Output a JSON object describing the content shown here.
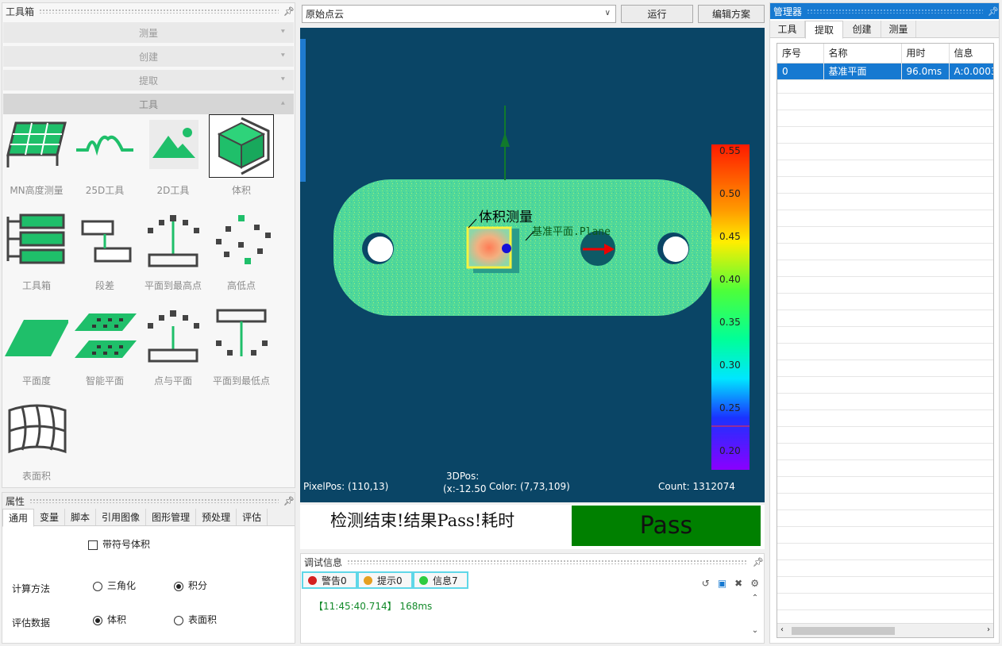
{
  "toolbox": {
    "title": "工具箱",
    "categories": [
      "测量",
      "创建",
      "提取",
      "工具"
    ],
    "tools": [
      "MN高度测量",
      "25D工具",
      "2D工具",
      "体积",
      "工具箱",
      "段差",
      "平面到最高点",
      "高低点",
      "平面度",
      "智能平面",
      "点与平面",
      "平面到最低点",
      "表面积"
    ]
  },
  "properties": {
    "title": "属性",
    "tabs": [
      "通用",
      "变量",
      "脚本",
      "引用图像",
      "图形管理",
      "预处理",
      "评估"
    ],
    "signed_volume_label": "带符号体积",
    "calc_method_label": "计算方法",
    "calc_options": [
      "三角化",
      "积分"
    ],
    "calc_selected": "积分",
    "eval_label": "评估数据",
    "eval_options": [
      "体积",
      "表面积"
    ],
    "eval_selected": "体积"
  },
  "toolbar": {
    "source_select": "原始点云",
    "run_label": "运行",
    "edit_label": "编辑方案"
  },
  "viewer": {
    "measure_label": "体积测量",
    "plane_label": "基准平面.Plane",
    "colorbar_ticks": [
      "0.55",
      "0.50",
      "0.45",
      "0.40",
      "0.35",
      "0.30",
      "0.25",
      "0.20"
    ],
    "pixel_pos": "PixelPos: (110,13)",
    "pos3d_line1": "3DPos:",
    "pos3d_line2": "(x:-12.50",
    "color": "Color: (7,73,109)",
    "count": "Count: 1312074"
  },
  "result": {
    "message": "检测结束!结果Pass!耗时",
    "status": "Pass",
    "status_color": "#008000"
  },
  "debug": {
    "title": "调试信息",
    "warning": "警告0",
    "hint": "提示0",
    "info": "信息7",
    "log": "【11:45:40.714】 168ms"
  },
  "manager": {
    "title": "管理器",
    "tabs": [
      "工具",
      "提取",
      "创建",
      "测量"
    ],
    "columns": [
      "序号",
      "名称",
      "用时",
      "信息"
    ],
    "rows": [
      {
        "index": "0",
        "name": "基准平面",
        "time": "96.0ms",
        "info": "A:0.0003"
      }
    ]
  },
  "colors": {
    "accent": "#1679d1",
    "viewer_bg": "#0a4566",
    "tool_green": "#1fbf6a"
  }
}
